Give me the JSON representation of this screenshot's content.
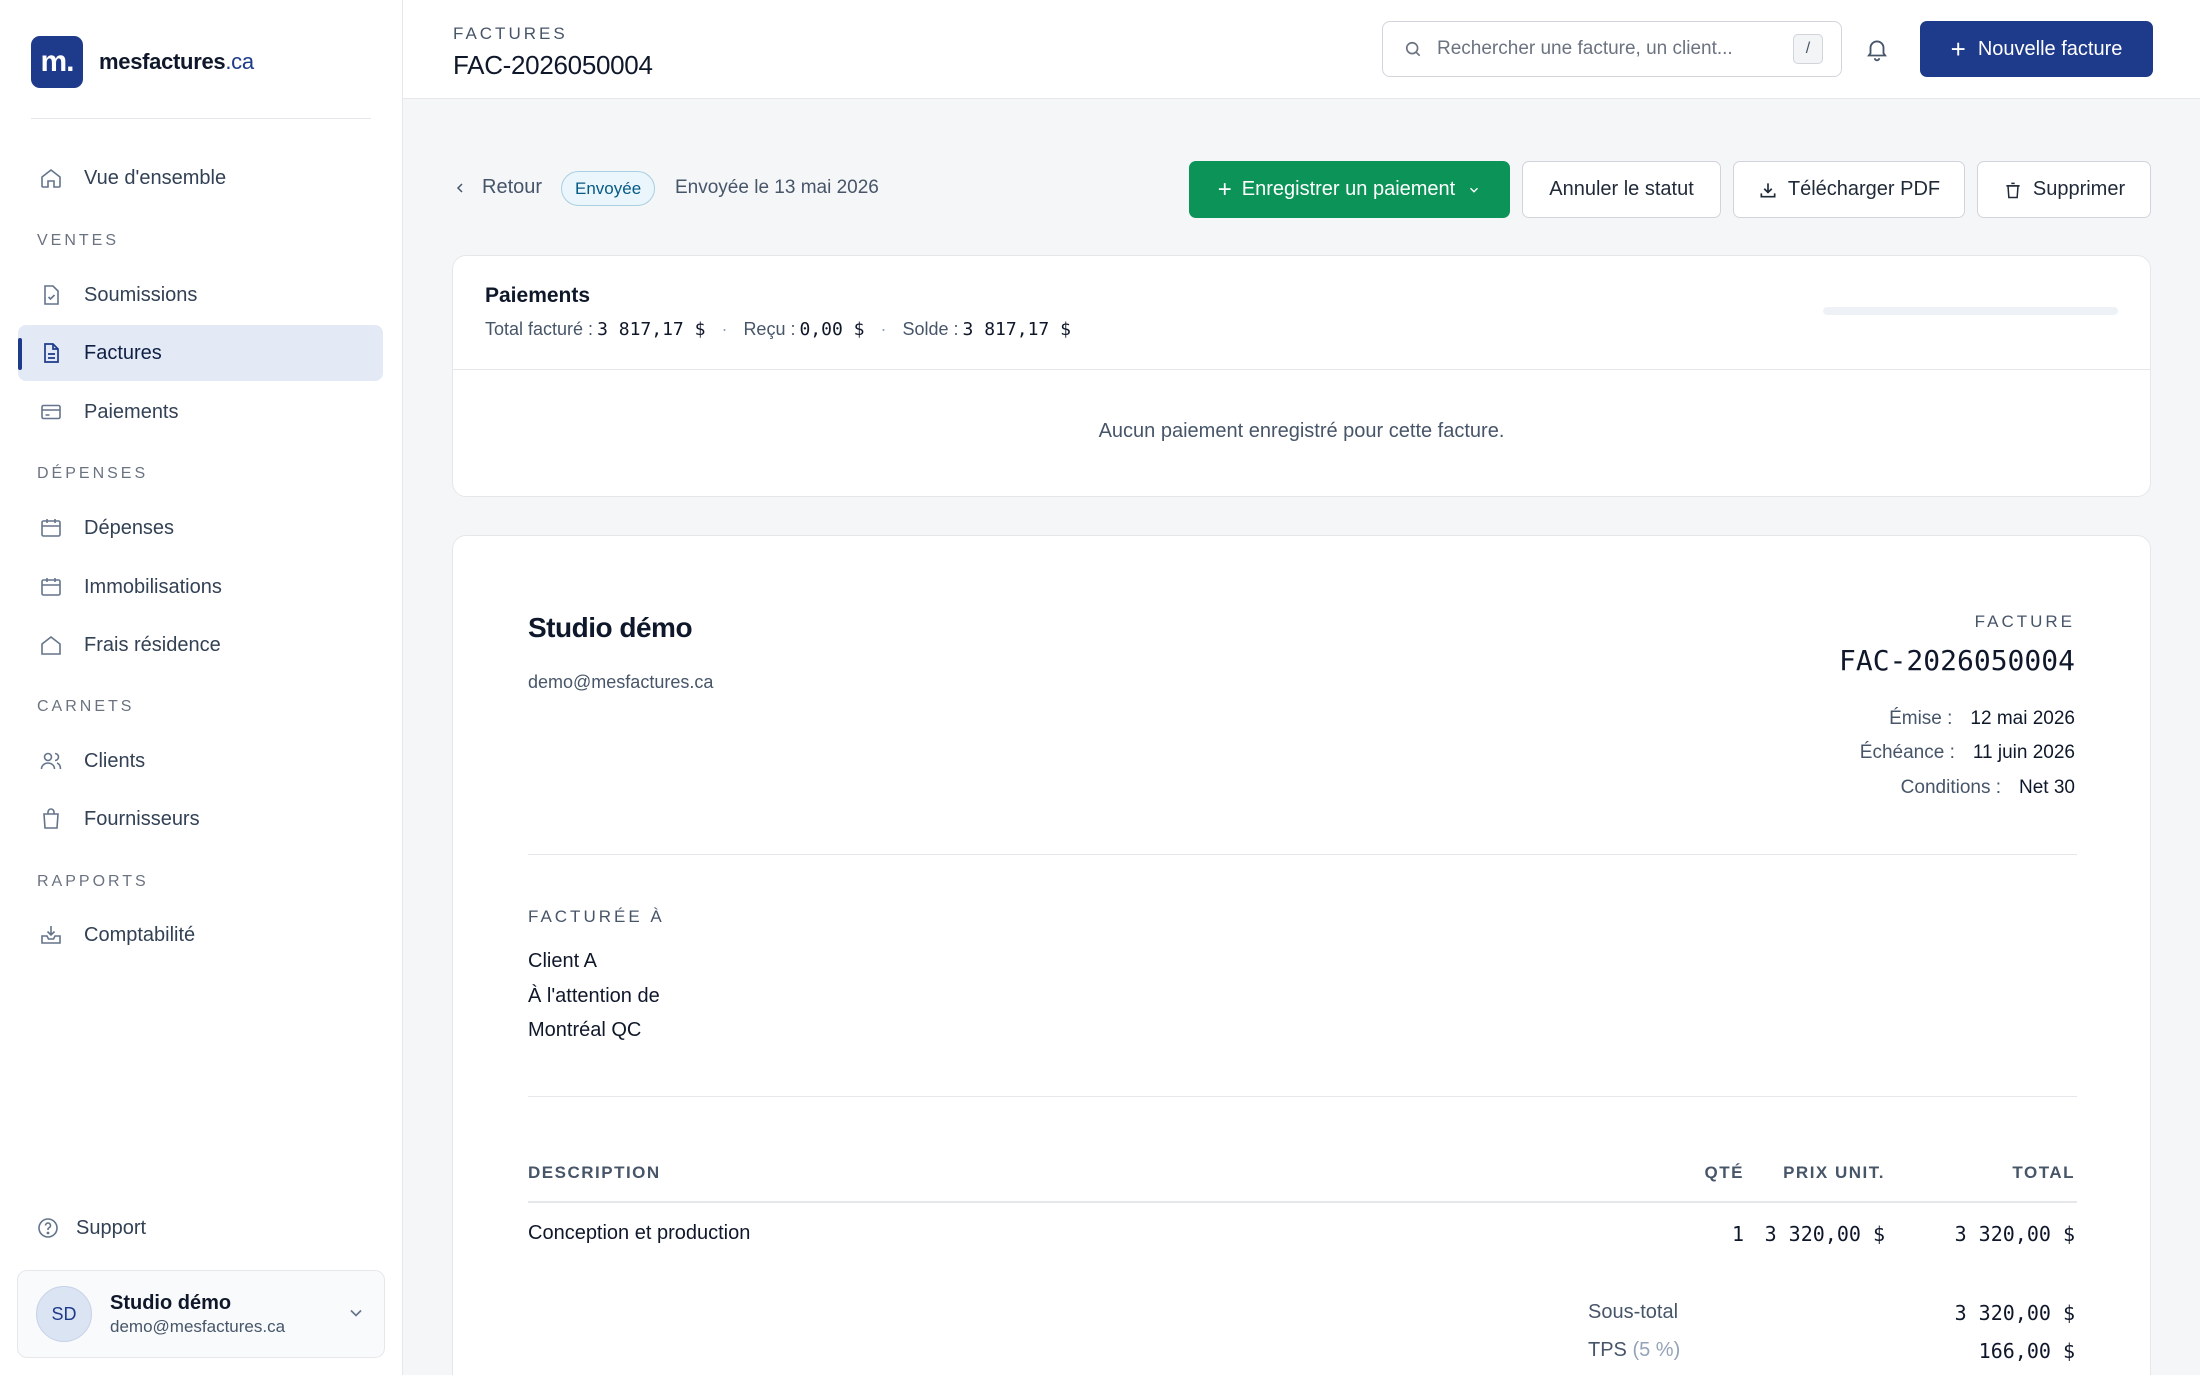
{
  "brand": {
    "logo": "m.",
    "name": "mesfactures",
    "tld": ".ca"
  },
  "sidebar": {
    "overview": "Vue d'ensemble",
    "sections": {
      "ventes": "VENTES",
      "depenses": "DÉPENSES",
      "carnets": "CARNETS",
      "rapports": "RAPPORTS"
    },
    "items": {
      "soumissions": "Soumissions",
      "factures": "Factures",
      "paiements": "Paiements",
      "depenses": "Dépenses",
      "immobilisations": "Immobilisations",
      "frais": "Frais résidence",
      "clients": "Clients",
      "fournisseurs": "Fournisseurs",
      "comptabilite": "Comptabilité"
    },
    "active_item": "Factures",
    "support": "Support",
    "user": {
      "initials": "SD",
      "name": "Studio démo",
      "email": "demo@mesfactures.ca"
    }
  },
  "topbar": {
    "eyebrow": "FACTURES",
    "title": "FAC-2026050004",
    "search_placeholder": "Rechercher une facture, un client...",
    "search_shortcut": "/",
    "new_invoice_label": "Nouvelle facture"
  },
  "actions": {
    "back_label": "Retour",
    "status": "Envoyée",
    "sent_on": "Envoyée le 13 mai 2026",
    "record_payment": "Enregistrer un paiement",
    "cancel_status": "Annuler le statut",
    "download_pdf": "Télécharger PDF",
    "delete": "Supprimer",
    "accent_green": "#0b9358",
    "accent_blue": "#1e3a8a"
  },
  "payments": {
    "title": "Paiements",
    "total_label": "Total facturé :",
    "total_value": "3 817,17 $",
    "received_label": "Reçu :",
    "received_value": "0,00 $",
    "balance_label": "Solde :",
    "balance_value": "3 817,17 $",
    "paid_fraction": 0,
    "empty_message": "Aucun paiement enregistré pour cette facture."
  },
  "invoice": {
    "company_name": "Studio démo",
    "company_email": "demo@mesfactures.ca",
    "doc_label": "FACTURE",
    "number": "FAC-2026050004",
    "issued_label": "Émise :",
    "issued_value": "12 mai 2026",
    "due_label": "Échéance :",
    "due_value": "11 juin 2026",
    "terms_label": "Conditions :",
    "terms_value": "Net 30",
    "billed_to_label": "FACTURÉE À",
    "billed_to": [
      "Client A",
      "À l'attention de",
      "Montréal QC"
    ],
    "columns": {
      "description": "DESCRIPTION",
      "qty": "QTÉ",
      "unit_price": "PRIX UNIT.",
      "total": "TOTAL"
    },
    "lines": [
      {
        "description": "Conception et production",
        "qty": "1",
        "unit_price": "3 320,00 $",
        "total": "3 320,00 $"
      }
    ],
    "subtotal_label": "Sous-total",
    "subtotal_value": "3 320,00 $",
    "tax_label": "TPS",
    "tax_rate": "(5 %)",
    "tax_value": "166,00 $"
  }
}
